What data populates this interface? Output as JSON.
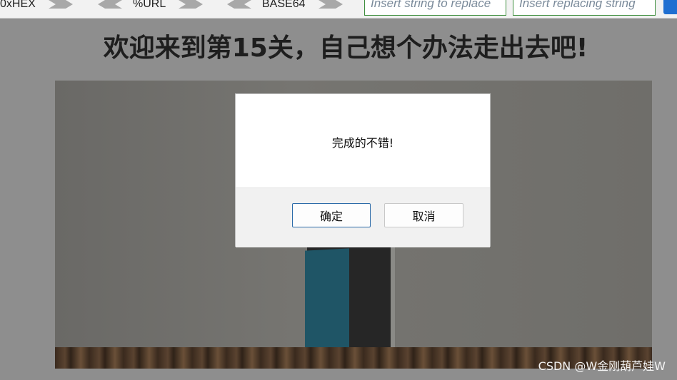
{
  "toolbar": {
    "hex_label": "0xHEX",
    "url_label": "%URL",
    "base64_label": "BASE64",
    "replace_placeholder": "Insert string to replace",
    "replacing_placeholder": "Insert replacing string"
  },
  "page": {
    "title": "欢迎来到第15关，自己想个办法走出去吧!"
  },
  "dialog": {
    "message": "完成的不错!",
    "ok_label": "确定",
    "cancel_label": "取消"
  },
  "watermark": "CSDN @W金刚葫芦娃W",
  "colors": {
    "overlay": "#8e8e8e",
    "toolbar_bg": "#f2f2f2",
    "input_border": "#3f8f3f",
    "ok_border": "#2a6aa8",
    "checkbox": "#1f6fd1"
  }
}
